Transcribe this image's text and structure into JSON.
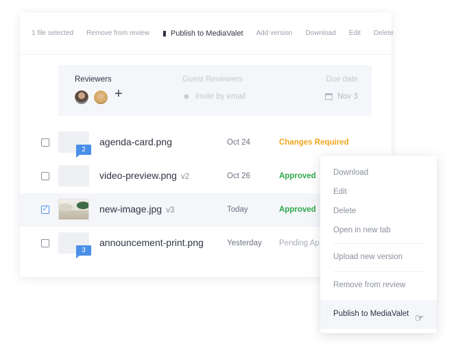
{
  "toolbar": {
    "selection_count": "1 file selected",
    "remove": "Remove from review",
    "publish": "Publish to MediaValet",
    "add_version": "Add version",
    "download": "Download",
    "edit": "Edit",
    "delete": "Delete"
  },
  "reviewers": {
    "label": "Reviewers",
    "guest_label": "Guest Reviewers",
    "invite": "Invite by email",
    "due_label": "Due date",
    "due_value": "Nov 3"
  },
  "files": [
    {
      "name": "agenda-card.png",
      "version": "",
      "date": "Oct 24",
      "status": "Changes Required",
      "comments": "2",
      "checked": false
    },
    {
      "name": "video-preview.png",
      "version": "v2",
      "date": "Oct 26",
      "status": "Approved",
      "comments": "",
      "checked": false
    },
    {
      "name": "new-image.jpg",
      "version": "v3",
      "date": "Today",
      "status": "Approved",
      "comments": "",
      "checked": true
    },
    {
      "name": "announcement-print.png",
      "version": "",
      "date": "Yesterday",
      "status": "Pending Ap",
      "comments": "3",
      "checked": false
    }
  ],
  "context_menu": {
    "download": "Download",
    "edit": "Edit",
    "delete": "Delete",
    "open_new_tab": "Open in new tab",
    "upload_version": "Upload new version",
    "remove": "Remove from review",
    "publish": "Publish to MediaValet"
  },
  "colors": {
    "accent": "#4a8fe7",
    "changes_required": "#f0a71e",
    "approved": "#2ea84a",
    "pending": "#a7adb7"
  }
}
